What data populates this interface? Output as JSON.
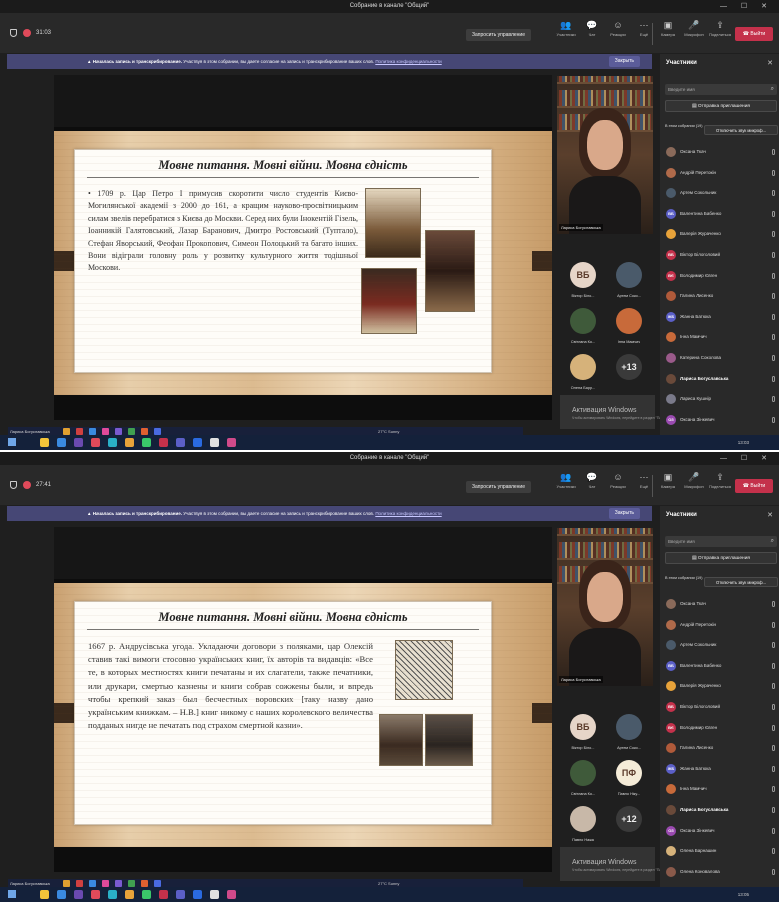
{
  "window_title": "Собрание в канале \"Общий\"",
  "accent": "#464775",
  "leave_color": "#c4314b",
  "screens": [
    {
      "timer": "31:03",
      "request_control": "Запросить управление",
      "toolbar": [
        "Участники",
        "Чат",
        "Реакции",
        "Ещё"
      ],
      "toolbar2": [
        "Камера",
        "Микрофон",
        "Поделиться"
      ],
      "leave": "Выйти",
      "banner": {
        "bold": "Началась запись и транскрибирование.",
        "text": "Участвуя в этом собрании, вы даете согласие на запись и транскрибирование ваших слов.",
        "link": "Политика конфиденциальности",
        "close": "Закрыть"
      },
      "slide": {
        "title": "Мовне питання. Мовні війни. Мовна єдність",
        "body": "• 1709 р. Цар Петро І примусив скоротити число студентів Києво-Могилянської академії з 2000 до 161, а кращим науково-просвітницьким силам звелів перебратися з Києва до Москви. Серед них були Інокентій Гізель, Іоанникій Галятовський, Лазар Баранович, Дмитро Ростовський (Туптало), Стефан Яворський, Феофан Прокопович, Симеон Полоцький та багато інших. Вони відіграли головну роль у розвитку культурного життя тодішньої Москови."
      },
      "presenter_name": "Лариса Богуславська",
      "video_name": "Лариса Богуславська",
      "weather": "27°C Sunny",
      "clock": "13:03",
      "tiles": [
        {
          "initials": "ВБ",
          "name": "Віктор Біло...",
          "color": "#e6d5c8"
        },
        {
          "initials": "",
          "name": "Артем Соко...",
          "color": "#4a5a6a"
        },
        {
          "initials": "",
          "name": "Світлана Ко...",
          "color": "#3f5a3a"
        },
        {
          "initials": "",
          "name": "Інна Мамчич",
          "color": "#c86a3a"
        },
        {
          "initials": "",
          "name": "Олена Барр...",
          "color": "#d6b27a"
        },
        {
          "initials": "+13",
          "name": "",
          "color": "#3a3a3a"
        }
      ],
      "activate": {
        "title": "Активация Windows",
        "sub": "Чтобы активировать Windows, перейдите в раздел \"Параметры\"."
      },
      "panel": {
        "title": "Участники",
        "search": "Введите имя",
        "invite": "Отправка приглашения",
        "meeting": "В этом собрании (19)",
        "mute": "Отключить звук микроф...",
        "people": [
          {
            "name": "Оксана Ткач",
            "color": "#8a6a5a",
            "initials": ""
          },
          {
            "name": "Андрій Перетокін",
            "color": "#b06a4a",
            "initials": ""
          },
          {
            "name": "Артем Сокольник",
            "color": "#4a5a6a",
            "initials": ""
          },
          {
            "name": "Валентина Бабенко",
            "color": "#5b5fc7",
            "initials": "ВБ"
          },
          {
            "name": "Валерія Жураченко",
            "color": "#e8a33a",
            "initials": ""
          },
          {
            "name": "Віктор Білоголовий",
            "color": "#c4314b",
            "initials": "ВБ"
          },
          {
            "name": "Володимир Євген",
            "color": "#c4314b",
            "initials": "ВЄ"
          },
          {
            "name": "Галина Лисенко",
            "color": "#b05a3a",
            "initials": ""
          },
          {
            "name": "Жанна Батюка",
            "color": "#5b5fc7",
            "initials": "ЖБ"
          },
          {
            "name": "Інна Мамчич",
            "color": "#c86a3a",
            "initials": ""
          },
          {
            "name": "Катерина Соколова",
            "color": "#9a5a8a",
            "initials": ""
          },
          {
            "name": "Лариса Богуславська",
            "color": "#6a4a3a",
            "initials": "",
            "bold": true
          },
          {
            "name": "Лариса Кушнір",
            "color": "#7a7a8a",
            "initials": ""
          },
          {
            "name": "Оксана Зінкевич",
            "color": "#9a4ab0",
            "initials": "ОЗ"
          },
          {
            "name": "Олена Барнашин",
            "color": "#d6b27a",
            "initials": ""
          }
        ]
      }
    },
    {
      "timer": "27:41",
      "request_control": "Запросить управление",
      "toolbar": [
        "Участники",
        "Чат",
        "Реакции",
        "Ещё"
      ],
      "toolbar2": [
        "Камера",
        "Микрофон",
        "Поделиться"
      ],
      "leave": "Выйти",
      "banner": {
        "bold": "Началась запись и транскрибирование.",
        "text": "Участвуя в этом собрании, вы даете согласие на запись и транскрибирование ваших слов.",
        "link": "Политика конфиденциальности",
        "close": "Закрыть"
      },
      "slide": {
        "title": "Мовне питання. Мовні війни. Мовна єдність",
        "body": "1667 р. Андрусівська угода. Укладаючи договори з поляками, цар Олексій ставив такі вимоги стосовно українських книг, їх авторів та видавців: «Все те, в которых местностях книги печатаны и их слагатели, также печатники, или друкари, смертью казнены и книги собрав сожжены были, и впредь чтобы крепкий заказ был бесчестных воровских [таку назву дано українським книжкам. – Н.В.] книг никому с наших королевского величества подданых нигде не печатать под страхом смертной казни»."
      },
      "presenter_name": "Лариса Богуславська",
      "video_name": "Лариса Богуславська",
      "weather": "27°C Sunny",
      "clock": "13:05",
      "tiles": [
        {
          "initials": "ВБ",
          "name": "Віктор Біло...",
          "color": "#e6d5c8"
        },
        {
          "initials": "",
          "name": "Артем Соко...",
          "color": "#4a5a6a"
        },
        {
          "initials": "",
          "name": "Світлана Ко...",
          "color": "#3f5a3a"
        },
        {
          "initials": "ПФ",
          "name": "Павло Ніку...",
          "color": "#f5ecd8"
        },
        {
          "initials": "",
          "name": "Павло Нажа",
          "color": "#c8b8a8"
        },
        {
          "initials": "+12",
          "name": "",
          "color": "#3a3a3a"
        }
      ],
      "activate": {
        "title": "Активация Windows",
        "sub": "Чтобы активировать Windows, перейдите в раздел \"Параметры\"."
      },
      "panel": {
        "title": "Участники",
        "search": "Введите имя",
        "invite": "Отправка приглашения",
        "meeting": "В этом собрании (19)",
        "mute": "Отключить звук микроф...",
        "people": [
          {
            "name": "Оксана Ткач",
            "color": "#8a6a5a",
            "initials": ""
          },
          {
            "name": "Андрій Перетокін",
            "color": "#b06a4a",
            "initials": ""
          },
          {
            "name": "Артем Сокольник",
            "color": "#4a5a6a",
            "initials": ""
          },
          {
            "name": "Валентина Бабенко",
            "color": "#5b5fc7",
            "initials": "ВБ"
          },
          {
            "name": "Валерія Жураченко",
            "color": "#e8a33a",
            "initials": ""
          },
          {
            "name": "Віктор Білоголовий",
            "color": "#c4314b",
            "initials": "ВБ"
          },
          {
            "name": "Володимир Євген",
            "color": "#c4314b",
            "initials": "ВЄ"
          },
          {
            "name": "Галина Лисенко",
            "color": "#b05a3a",
            "initials": ""
          },
          {
            "name": "Жанна Батюка",
            "color": "#5b5fc7",
            "initials": "ЖБ"
          },
          {
            "name": "Інна Мамчич",
            "color": "#c86a3a",
            "initials": ""
          },
          {
            "name": "Лариса Богуславська",
            "color": "#6a4a3a",
            "initials": "",
            "bold": true
          },
          {
            "name": "Оксана Зінкевич",
            "color": "#9a4ab0",
            "initials": "ОЗ"
          },
          {
            "name": "Олена Барнашин",
            "color": "#d6b27a",
            "initials": ""
          },
          {
            "name": "Олена Коновалова",
            "color": "#8a5a4a",
            "initials": ""
          },
          {
            "name": "Павло Нажа",
            "color": "#c8b8a8",
            "initials": ""
          }
        ]
      }
    }
  ]
}
